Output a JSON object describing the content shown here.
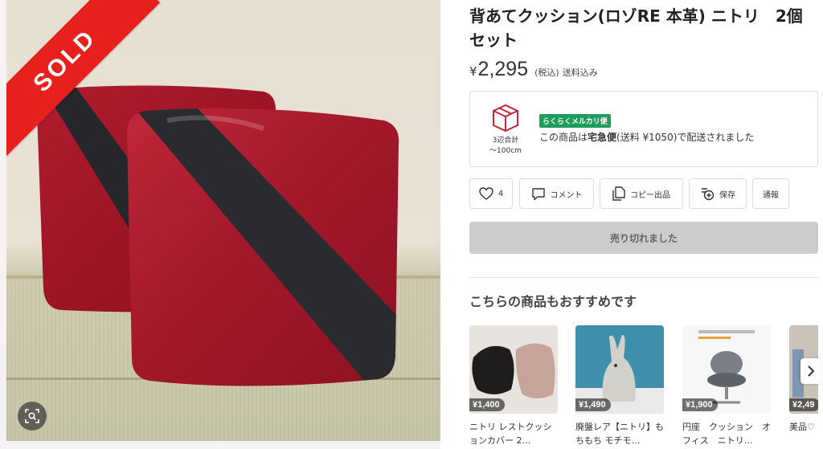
{
  "product": {
    "title": "背あてクッション(ロゾRE 本革) ニトリ　2個セット",
    "currency": "¥",
    "price": "2,295",
    "tax_note": "(税込)",
    "shipping_note": "送料込み",
    "sold_ribbon": "SOLD"
  },
  "shipping": {
    "size_label_line1": "3辺合計",
    "size_label_line2": "〜100cm",
    "badge": "らくらくメルカリ便",
    "text_prefix": "この商品は",
    "method": "宅急便",
    "fee": "(送料 ¥1050)",
    "text_suffix": "で配送されました"
  },
  "actions": {
    "like_count": "4",
    "comment": "コメント",
    "copy_listing": "コピー出品",
    "save": "保存",
    "report": "通報"
  },
  "sold_button": "売り切れました",
  "recommendations": {
    "title": "こちらの商品もおすすめです",
    "items": [
      {
        "price": "¥1,400",
        "name": "ニトリ レストクッションカバー 2…"
      },
      {
        "price": "¥1,490",
        "name": "廃盤レア【ニトリ】もちもち モチモ…"
      },
      {
        "price": "¥1,900",
        "name": "円座　クッション　オフィス　ニトリ…"
      },
      {
        "price": "¥2,49",
        "name": "美品♡ ングシ"
      }
    ]
  },
  "colors": {
    "sold_red": "#e8201d",
    "badge_green": "#1f9d5a",
    "sold_button_gray": "#cccccc",
    "cushion_red": "#a8182a",
    "cushion_band": "#2a2b30"
  },
  "icons": [
    "image-search-icon",
    "box-icon",
    "heart-icon",
    "comment-icon",
    "copy-icon",
    "save-add-icon",
    "chevron-right-icon"
  ]
}
